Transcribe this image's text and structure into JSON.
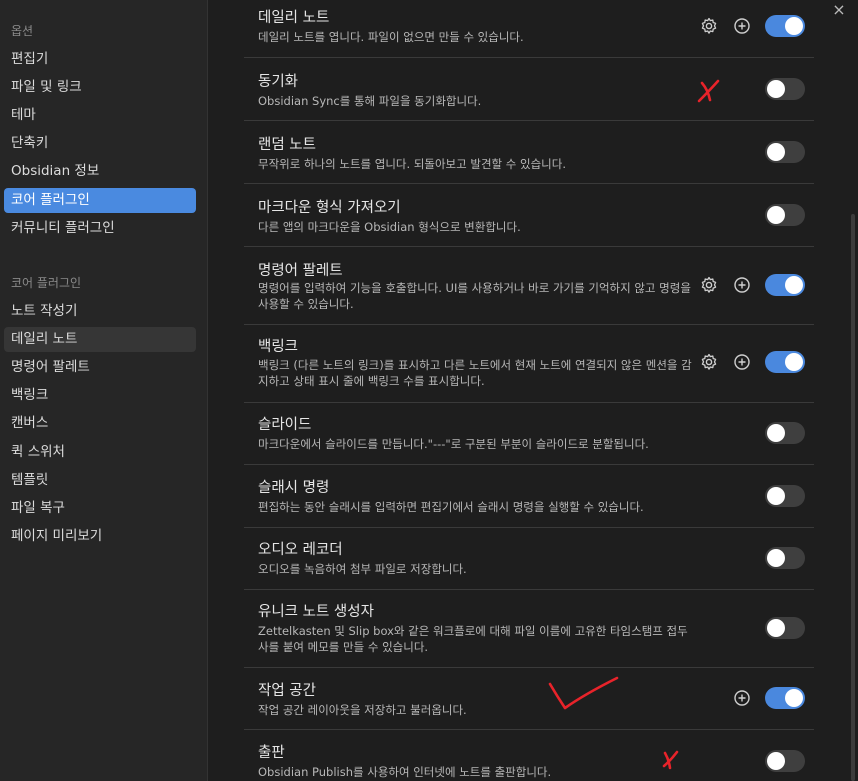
{
  "sidebar": {
    "header_options": "옵션",
    "options": [
      {
        "label": "편집기"
      },
      {
        "label": "파일 및 링크"
      },
      {
        "label": "테마"
      },
      {
        "label": "단축키"
      },
      {
        "label": "Obsidian 정보"
      },
      {
        "label": "코어 플러그인"
      },
      {
        "label": "커뮤니티 플러그인"
      }
    ],
    "header_core": "코어 플러그인",
    "core": [
      {
        "label": "노트 작성기"
      },
      {
        "label": "데일리 노트"
      },
      {
        "label": "명령어 팔레트"
      },
      {
        "label": "백링크"
      },
      {
        "label": "캔버스"
      },
      {
        "label": "퀵 스위처"
      },
      {
        "label": "템플릿"
      },
      {
        "label": "파일 복구"
      },
      {
        "label": "페이지 미리보기"
      }
    ]
  },
  "close_icon": "×",
  "plugins": [
    {
      "title": "데일리 노트",
      "desc": "데일리 노트를 엽니다. 파일이 없으면 만들 수 있습니다.",
      "enabled": true,
      "settings": true,
      "add": true
    },
    {
      "title": "동기화",
      "desc": "Obsidian Sync를 통해 파일을 동기화합니다.",
      "enabled": false
    },
    {
      "title": "랜덤 노트",
      "desc": "무작위로 하나의 노트를 엽니다. 되돌아보고 발견할 수 있습니다.",
      "enabled": false
    },
    {
      "title": "마크다운 형식 가져오기",
      "desc": "다른 앱의 마크다운을 Obsidian 형식으로 변환합니다.",
      "enabled": false
    },
    {
      "title": "명령어 팔레트",
      "desc": "명령어를 입력하여 기능을 호출합니다. UI를 사용하거나 바로 가기를 기억하지 않고 명령을 사용할 수 있습니다.",
      "enabled": true,
      "settings": true,
      "add": true
    },
    {
      "title": "백링크",
      "desc": "백링크 (다른 노트의 링크)를 표시하고 다른 노트에서 현재 노트에 연결되지 않은 멘션을 감지하고 상태 표시 줄에 백링크 수를 표시합니다.",
      "enabled": true,
      "settings": true,
      "add": true
    },
    {
      "title": "슬라이드",
      "desc": "마크다운에서 슬라이드를 만듭니다.\"---\"로 구분된 부분이 슬라이드로 분할됩니다.",
      "enabled": false
    },
    {
      "title": "슬래시 명령",
      "desc": "편집하는 동안 슬래시를 입력하면 편집기에서 슬래시 명령을 실행할 수 있습니다.",
      "enabled": false
    },
    {
      "title": "오디오 레코더",
      "desc": "오디오를 녹음하여 첨부 파일로 저장합니다.",
      "enabled": false
    },
    {
      "title": "유니크 노트 생성자",
      "desc": "Zettelkasten 및 Slip box와 같은 워크플로에 대해 파일 이름에 고유한 타임스탬프 접두사를 붙여 메모를 만들 수 있습니다.",
      "enabled": false
    },
    {
      "title": "작업 공간",
      "desc": "작업 공간 레이아웃을 저장하고 불러옵니다.",
      "enabled": true,
      "add": true
    },
    {
      "title": "출판",
      "desc": "Obsidian Publish를 사용하여 인터넷에 노트를 출판합니다.",
      "enabled": false
    }
  ],
  "icons": {
    "settings": "gear-icon",
    "add": "plus-circle-icon",
    "close": "close-icon"
  },
  "colors": {
    "accent": "#4a88de",
    "annotation": "#e8232a"
  }
}
